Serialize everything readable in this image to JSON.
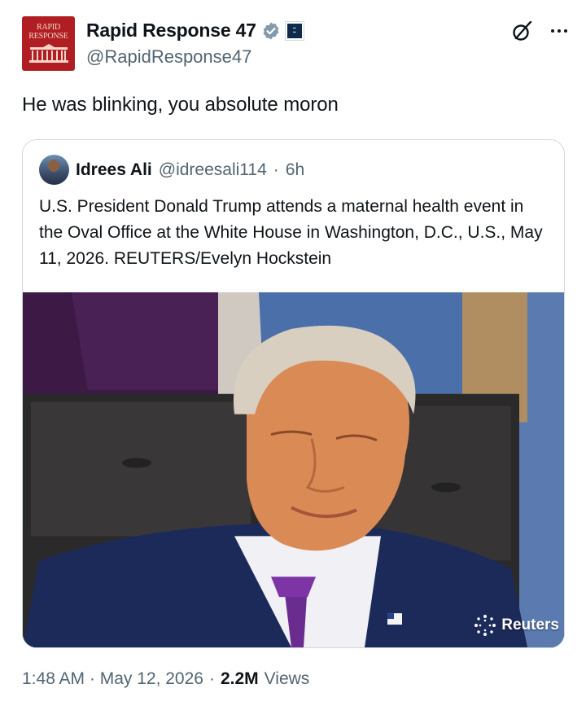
{
  "post": {
    "author": {
      "display_name": "Rapid Response 47",
      "handle": "@RapidResponse47",
      "avatar_logo_text": "RAPID RESPONSE",
      "verified_badge": "verified-badge-icon",
      "affiliate_badge": "affiliate-badge-icon"
    },
    "text": "He was blinking, you absolute moron",
    "timestamp": "1:48 AM · May 12, 2026",
    "separator": "·",
    "views_count": "2.2M",
    "views_label": "Views"
  },
  "quoted_post": {
    "author_name": "Idrees Ali",
    "author_handle": "@idreesali114",
    "separator": "·",
    "age": "6h",
    "text": "U.S. President Donald Trump attends a maternal health event in the Oval Office at the White House in Washington, D.C., U.S., May 11, 2026. REUTERS/Evelyn Hockstein",
    "photo_watermark": "Reuters"
  },
  "icons": {
    "grok": "grok-icon",
    "more": "more-options-icon"
  },
  "colors": {
    "text_primary": "#0f1419",
    "text_secondary": "#536471",
    "border": "#cfd9de",
    "brand_red": "#b01e23",
    "verified_gray": "#829aab"
  }
}
